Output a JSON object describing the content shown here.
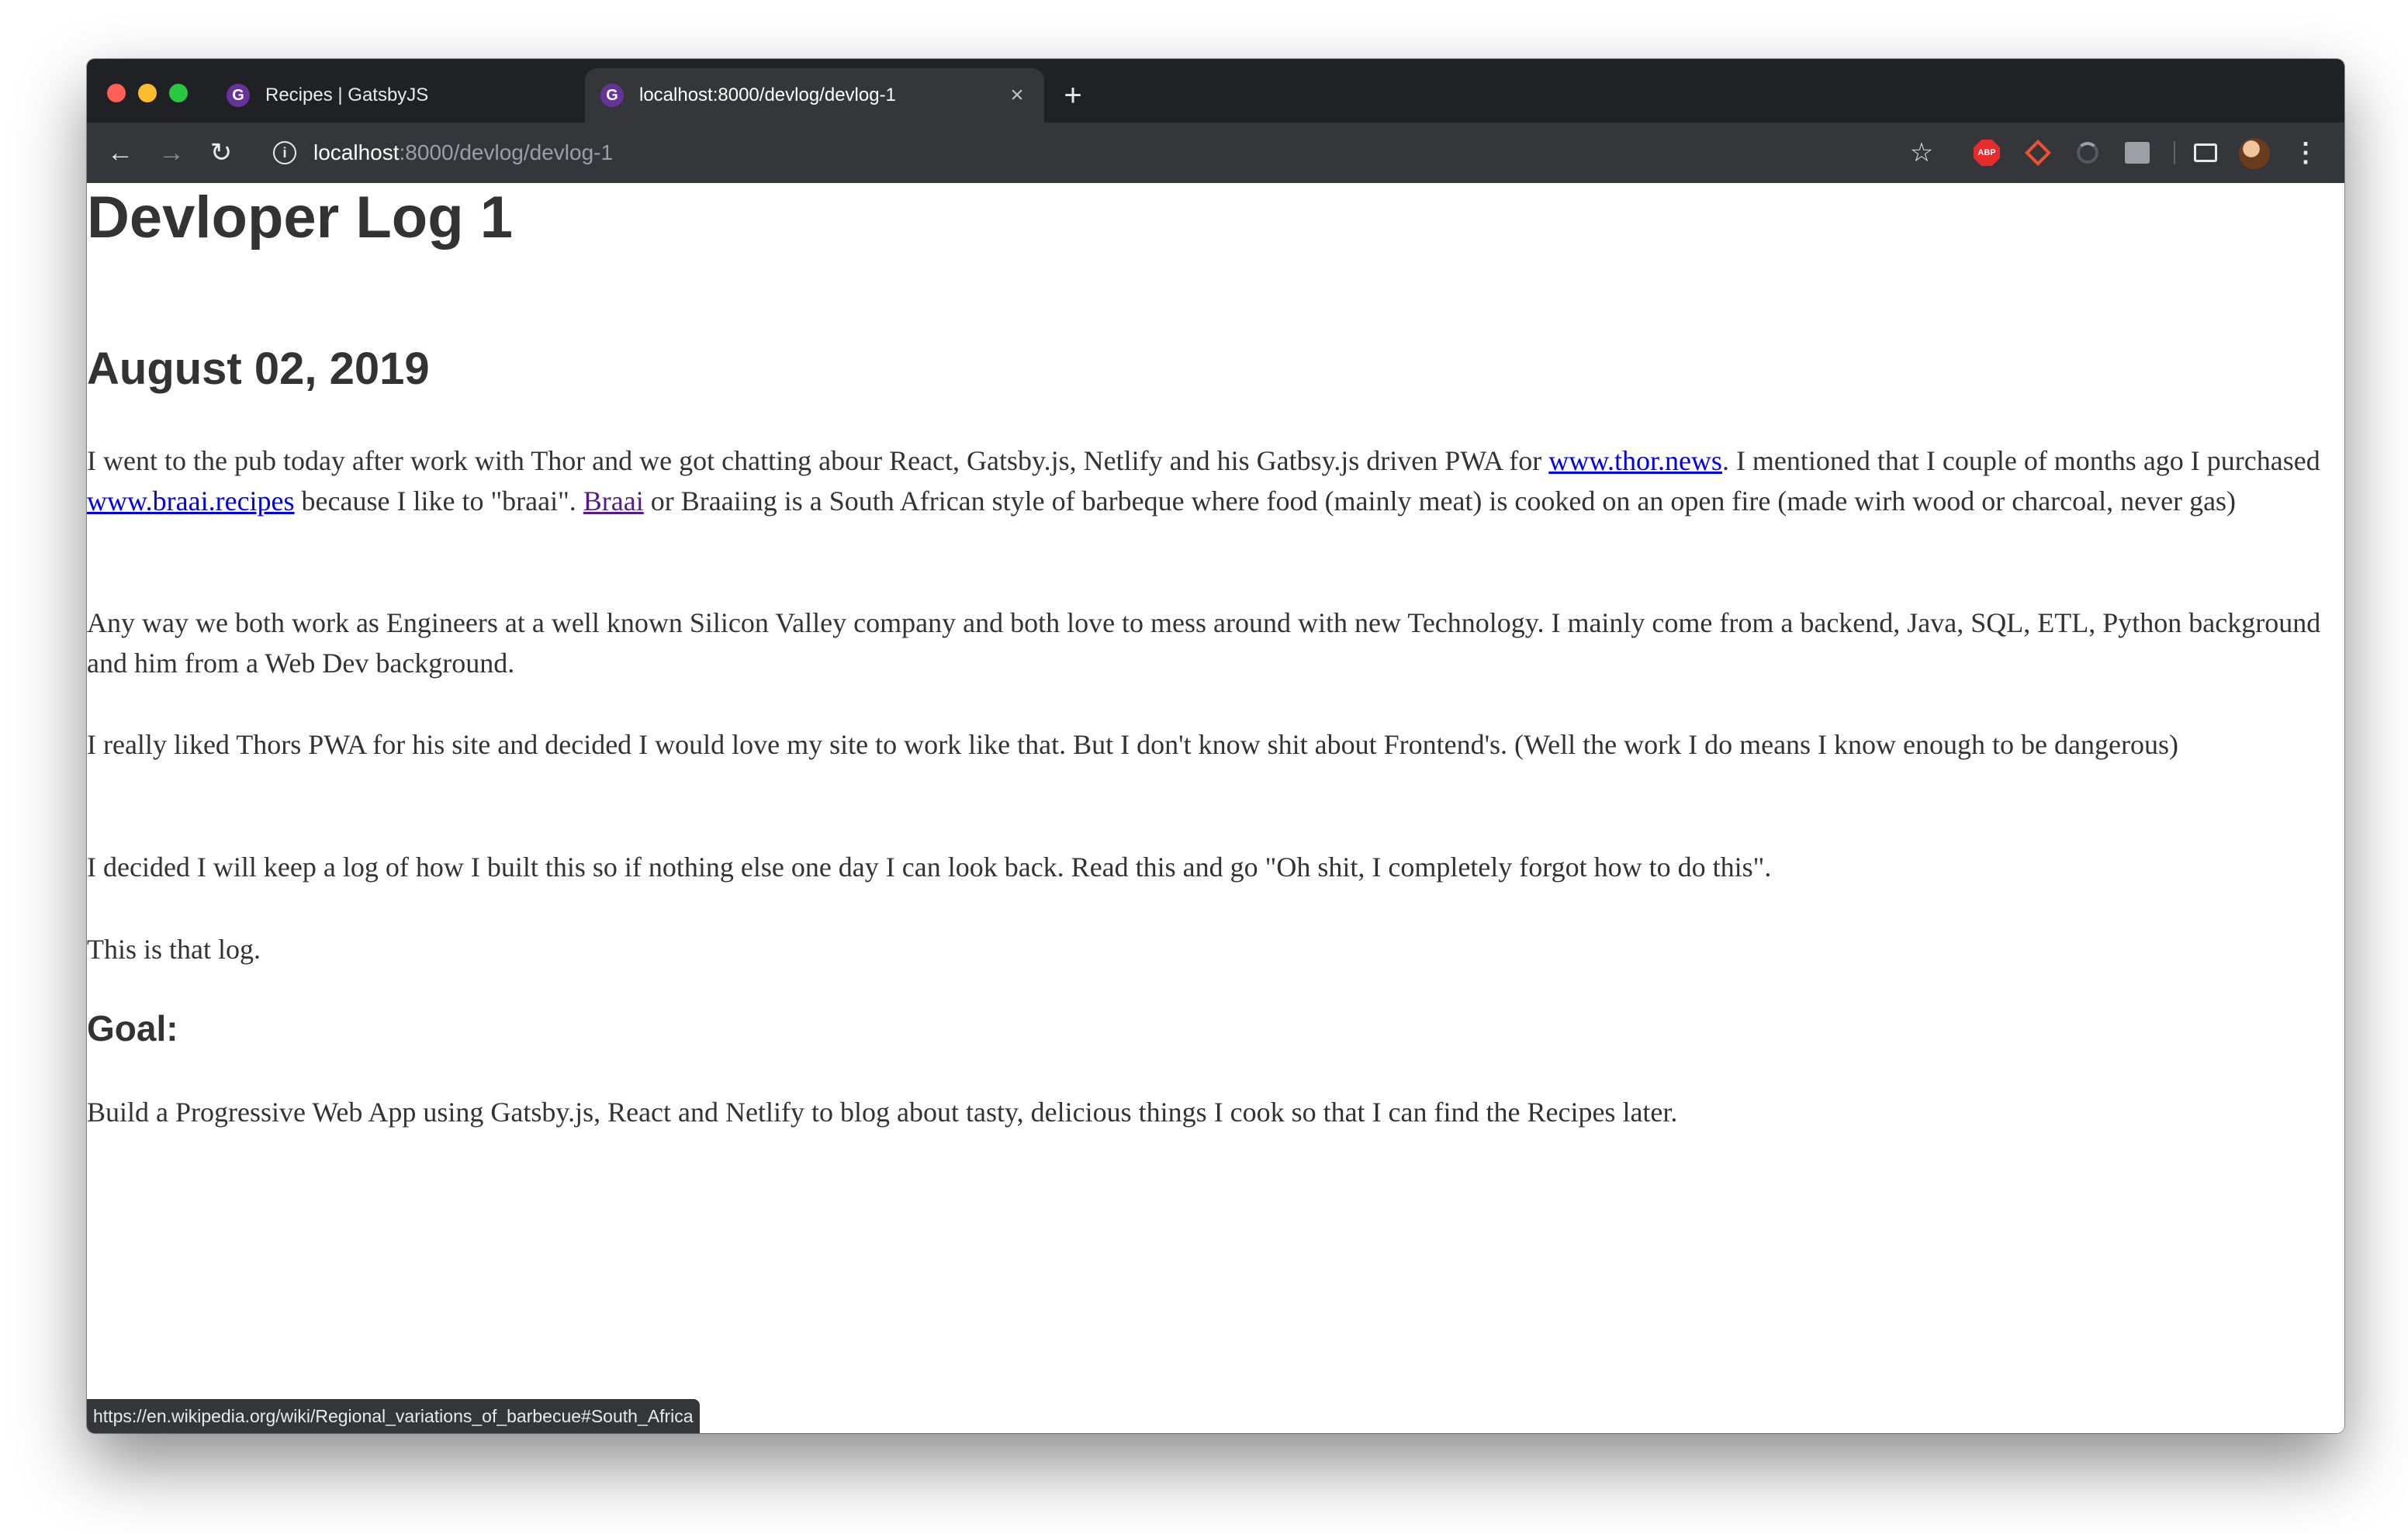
{
  "tabs": [
    {
      "title": "Recipes | GatsbyJS",
      "favicon": "gatsby-icon"
    },
    {
      "title": "localhost:8000/devlog/devlog-1",
      "favicon": "gatsby-icon"
    }
  ],
  "tab_close_glyph": "×",
  "new_tab_glyph": "+",
  "toolbar": {
    "back_glyph": "←",
    "forward_glyph": "→",
    "reload_glyph": "↻",
    "star_glyph": "☆",
    "menu_glyph": "⋮",
    "info_glyph": "i",
    "abp_label": "ABP"
  },
  "address": {
    "host": "localhost",
    "path": ":8000/devlog/devlog-1"
  },
  "page": {
    "title": "Devloper Log 1",
    "date": "August 02, 2019",
    "p1": {
      "a": "I went to the pub today after work with Thor and we got chatting abour React, Gatsby.js, Netlify and his Gatbsy.js driven PWA for ",
      "link1": "www.thor.news",
      "b": ". I mentioned that I couple of months ago I purchased ",
      "link2": "www.braai.recipes",
      "c": " because I like to \"braai\". ",
      "link3": "Braai",
      "d": " or Braaiing is a South African style of barbeque where food (mainly meat) is cooked on an open fire (made wirh wood or charcoal, never gas)"
    },
    "p2": "Any way we both work as Engineers at a well known Silicon Valley company and both love to mess around with new Technology. I mainly come from a backend, Java, SQL, ETL, Python background and him from a Web Dev background.",
    "p3": "I really liked Thors PWA for his site and decided I would love my site to work like that. But I don't know shit about Frontend's. (Well the work I do means I know enough to be dangerous)",
    "p4": "I decided I will keep a log of how I built this so if nothing else one day I can look back. Read this and go \"Oh shit, I completely forgot how to do this\".",
    "p5": "This is that log.",
    "goal_heading": "Goal:",
    "p6": "Build a Progressive Web App using Gatsby.js, React and Netlify to blog about tasty, delicious things I cook so that I can find the Recipes later."
  },
  "status_url": "https://en.wikipedia.org/wiki/Regional_variations_of_barbecue#South_Africa",
  "colors": {
    "tab_strip": "#202124",
    "toolbar": "#35363a",
    "link": "#0000ee",
    "visited_link": "#551a8b",
    "text": "#333333",
    "gatsby_purple": "#663399"
  }
}
